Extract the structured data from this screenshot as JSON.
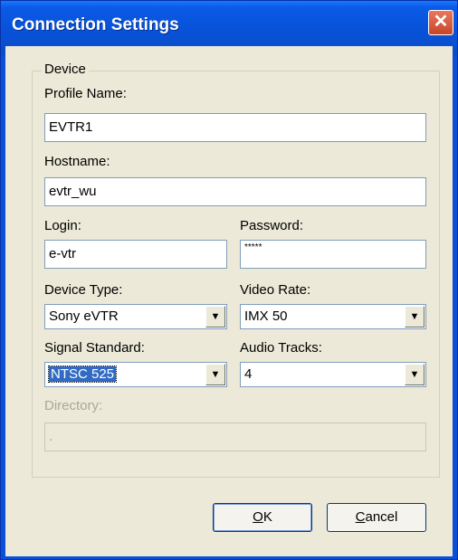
{
  "window": {
    "title": "Connection Settings",
    "close_glyph": "✕"
  },
  "group": {
    "label": "Device"
  },
  "profile": {
    "label": "Profile Name:",
    "value": "EVTR1"
  },
  "hostname": {
    "label": "Hostname:",
    "value": "evtr_wu"
  },
  "login": {
    "label": "Login:",
    "value": "e-vtr"
  },
  "password": {
    "label": "Password:",
    "value": "*****"
  },
  "device_type": {
    "label": "Device Type:",
    "value": "Sony eVTR"
  },
  "video_rate": {
    "label": "Video Rate:",
    "value": "IMX 50"
  },
  "signal_standard": {
    "label": "Signal Standard:",
    "value": "NTSC 525"
  },
  "audio_tracks": {
    "label": "Audio Tracks:",
    "value": "4"
  },
  "directory": {
    "label": "Directory:",
    "value": "."
  },
  "buttons": {
    "ok_mnemonic": "O",
    "ok_rest": "K",
    "cancel_mnemonic": "C",
    "cancel_rest": "ancel"
  },
  "icons": {
    "dropdown": "▼"
  }
}
